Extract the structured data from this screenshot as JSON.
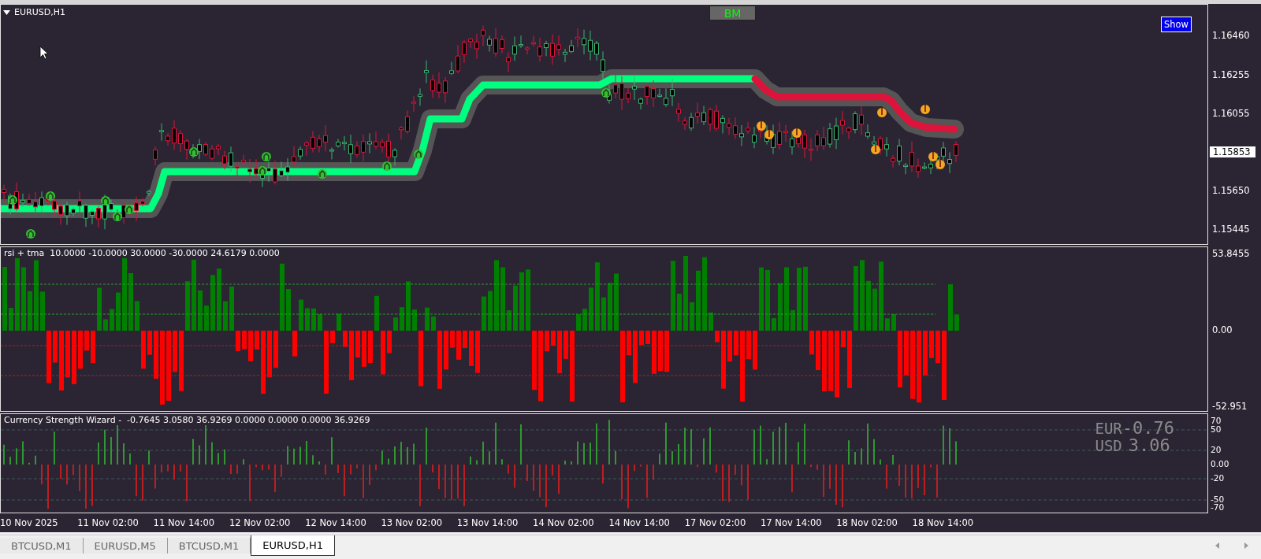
{
  "chart": {
    "title": "EURUSD,H1",
    "bm_button": "BM",
    "show_button": "Show",
    "price_ticks": [
      "1.16460",
      "1.16255",
      "1.16055",
      "1.15650",
      "1.15445"
    ],
    "current_price": "1.15853"
  },
  "rsi_panel": {
    "label": "rsi + tma  10.0000 -10.0000 30.0000 -30.0000 24.6179 0.0000",
    "scale": [
      "53.8455",
      "0.00",
      "-52.951"
    ]
  },
  "strength_panel": {
    "label": "Currency Strength Wizard -  -0.7645 3.0580 36.9269 0.0000 0.0000 0.0000 36.9269",
    "scale": [
      "70",
      "50",
      "20",
      "0.00",
      "-20",
      "-50",
      "-70"
    ],
    "readouts": [
      {
        "currency": "EUR",
        "value": "-0.76"
      },
      {
        "currency": "USD",
        "value": "3.06"
      }
    ]
  },
  "time_axis": [
    "10 Nov 2025",
    "11 Nov 02:00",
    "11 Nov 14:00",
    "12 Nov 02:00",
    "12 Nov 14:00",
    "13 Nov 02:00",
    "13 Nov 14:00",
    "14 Nov 02:00",
    "14 Nov 14:00",
    "17 Nov 02:00",
    "17 Nov 14:00",
    "18 Nov 02:00",
    "18 Nov 14:00"
  ],
  "tabs": [
    {
      "label": "BTCUSD,M1",
      "selected": false
    },
    {
      "label": "EURUSD,M5",
      "selected": false
    },
    {
      "label": "BTCUSD,M1",
      "selected": false
    },
    {
      "label": "EURUSD,H1",
      "selected": true
    }
  ]
}
